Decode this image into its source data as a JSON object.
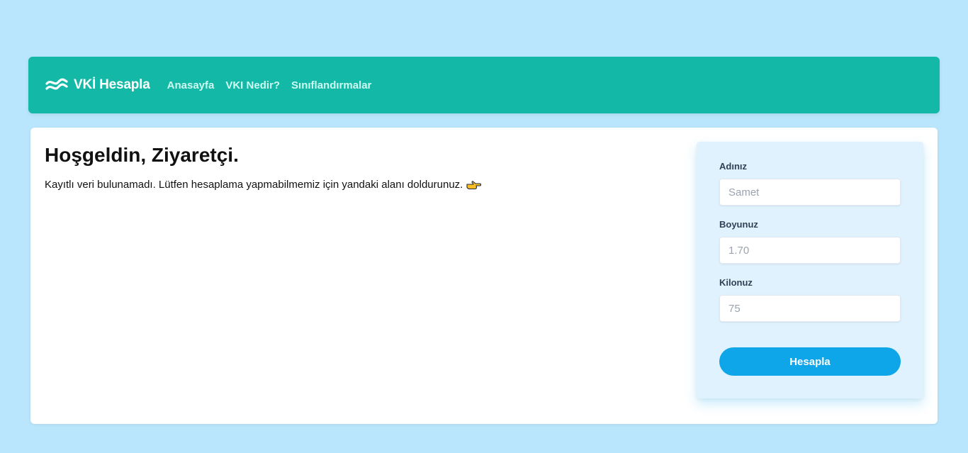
{
  "navbar": {
    "brand_icon": "wave-logo-icon",
    "brand_name": "VKİ Hesapla",
    "links": [
      {
        "label": "Anasayfa"
      },
      {
        "label": "VKI Nedir?"
      },
      {
        "label": "Sınıflandırmalar"
      }
    ]
  },
  "welcome": {
    "title": "Hoşgeldin, Ziyaretçi.",
    "message": "Kayıtlı veri bulunamadı. Lütfen hesaplama yapmabilmemiz için yandaki alanı doldurunuz.",
    "pointer_icon": "hand-pointing-right-icon"
  },
  "form": {
    "name_label": "Adınız",
    "name_placeholder": "Samet",
    "height_label": "Boyunuz",
    "height_placeholder": "1.70",
    "weight_label": "Kilonuz",
    "weight_placeholder": "75",
    "submit_label": "Hesapla"
  },
  "colors": {
    "background": "#bae6fd",
    "navbar": "#14b8a6",
    "nav_link": "#ccfbf1",
    "form_panel": "#e0f2fe",
    "button": "#0ea5e9"
  }
}
